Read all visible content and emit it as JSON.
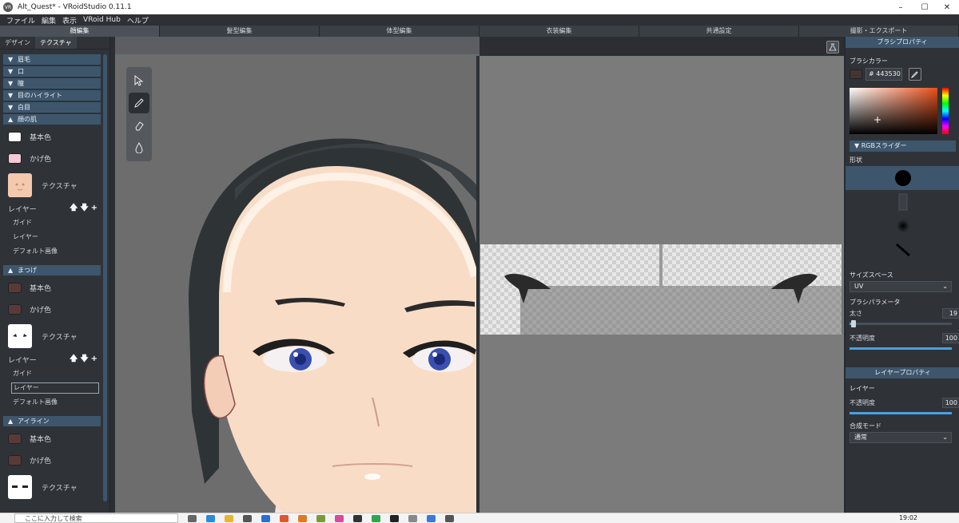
{
  "window": {
    "title": "Alt_Quest* - VRoidStudio 0.11.1",
    "app_icon": "VR",
    "controls": [
      "–",
      "☐",
      "✕"
    ]
  },
  "menu": [
    "ファイル",
    "編集",
    "表示",
    "VRoid Hub",
    "ヘルプ"
  ],
  "mode_tabs": [
    "顔編集",
    "髪型編集",
    "体型編集",
    "衣装編集",
    "共通設定",
    "撮影・エクスポート"
  ],
  "left_panel": {
    "subtabs": [
      "デザイン",
      "テクスチャ"
    ],
    "collapsed_sections": [
      "眉毛",
      "口",
      "瞳",
      "目のハイライト",
      "白目"
    ],
    "skin": {
      "header": "顔の肌",
      "base_color_label": "基本色",
      "shadow_color_label": "かげ色",
      "texture_label": "テクスチャ",
      "layer_label": "レイヤー",
      "layers": [
        "ガイド",
        "レイヤー",
        "デフォルト画像"
      ],
      "base_color": "#ffffff",
      "shadow_color": "#f6c8d2"
    },
    "eyelash": {
      "header": "まつげ",
      "base_color_label": "基本色",
      "shadow_color_label": "かげ色",
      "texture_label": "テクスチャ",
      "layer_label": "レイヤー",
      "layers": [
        "ガイド",
        "レイヤー",
        "デフォルト画像"
      ],
      "base_color": "#5a3a36",
      "shadow_color": "#5a3a36"
    },
    "eyeline": {
      "header": "アイライン",
      "base_color_label": "基本色",
      "shadow_color_label": "かげ色",
      "texture_label": "テクスチャ",
      "base_color": "#5a3a36",
      "shadow_color": "#5a3a36"
    }
  },
  "right_panel": {
    "brush_props_title": "ブラシプロパティ",
    "brush_color_label": "ブラシカラー",
    "hex_value": "# 443530",
    "rgb_slider_label": "RGBスライダー",
    "shape_label": "形状",
    "size_space_label": "サイズスペース",
    "size_space_value": "UV",
    "brush_params_label": "ブラシパラメータ",
    "thickness_label": "太さ",
    "thickness_value": "19",
    "opacity_label": "不透明度",
    "opacity_value": "100",
    "layer_props_title": "レイヤープロパティ",
    "layer_label": "レイヤー",
    "layer_opacity_label": "不透明度",
    "layer_opacity_value": "100",
    "blend_mode_label": "合成モード",
    "blend_mode_value": "通常",
    "accent_color": "#3d566c"
  },
  "taskbar": {
    "search_placeholder": "ここに入力して検索",
    "time": "19:02"
  }
}
